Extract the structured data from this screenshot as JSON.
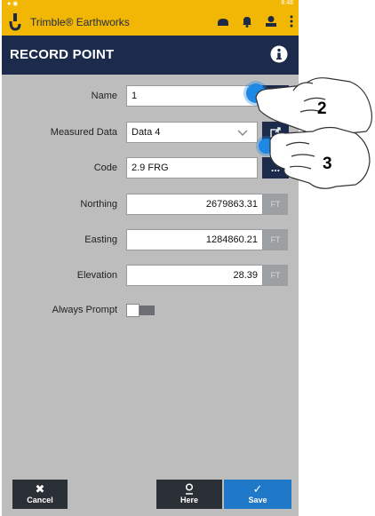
{
  "status_bar": {
    "time": "8:48"
  },
  "app": {
    "title": "Trimble® Earthworks"
  },
  "page": {
    "title": "RECORD POINT"
  },
  "form": {
    "name": {
      "label": "Name",
      "value": "1"
    },
    "measured_data": {
      "label": "Measured Data",
      "value": "Data 4"
    },
    "code": {
      "label": "Code",
      "value": "2.9 FRG",
      "button": "..."
    },
    "northing": {
      "label": "Northing",
      "value": "2679863.31",
      "unit": "FT"
    },
    "easting": {
      "label": "Easting",
      "value": "1284860.21",
      "unit": "FT"
    },
    "elevation": {
      "label": "Elevation",
      "value": "28.39",
      "unit": "FT"
    },
    "always_prompt": {
      "label": "Always Prompt",
      "on": false
    }
  },
  "footer": {
    "cancel": "Cancel",
    "here": "Here",
    "save": "Save"
  },
  "callouts": {
    "first": "2",
    "second": "3"
  },
  "colors": {
    "accent_yellow": "#f2b705",
    "navy": "#1c2b4c",
    "save_blue": "#1f78c8",
    "touch_blue": "#1e88e5"
  }
}
